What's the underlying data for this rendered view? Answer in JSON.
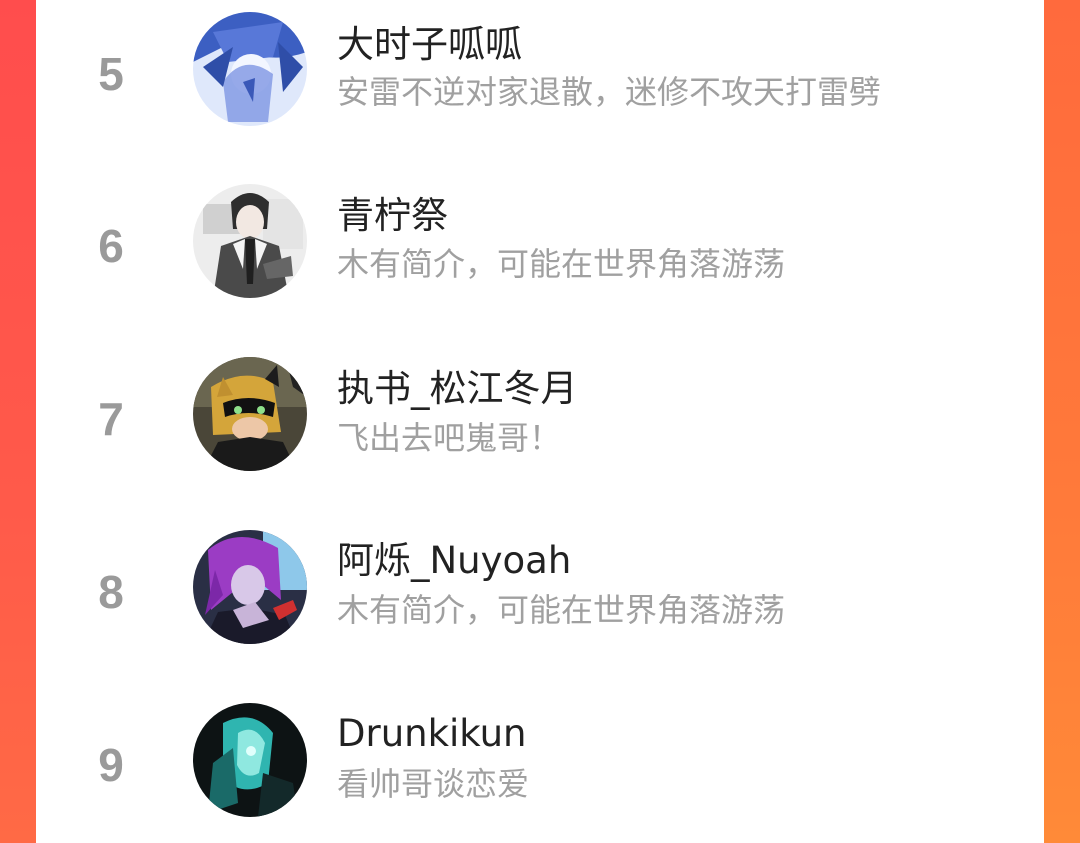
{
  "colors": {
    "left_edge": "#ff4d4d",
    "right_edge": "#ff7a3a",
    "card": "#ffffff",
    "rank_text": "#9a9a9a",
    "name_text": "#222222",
    "bio_text": "#a0a0a0"
  },
  "ranking": {
    "items": [
      {
        "rank": "5",
        "name": "大时子呱呱",
        "bio": "安雷不逆对家退散，迷修不攻天打雷劈",
        "avatar": "user-avatar-blue-anime"
      },
      {
        "rank": "6",
        "name": "青柠祭",
        "bio": "木有简介，可能在世界角落游荡",
        "avatar": "user-avatar-suit-anime"
      },
      {
        "rank": "7",
        "name": "执书_松江冬月",
        "bio": "飞出去吧嵬哥！",
        "avatar": "user-avatar-masked-hero"
      },
      {
        "rank": "8",
        "name": "阿烁_Nuyoah",
        "bio": "木有简介，可能在世界角落游荡",
        "avatar": "user-avatar-purple-hair"
      },
      {
        "rank": "9",
        "name": "Drunkikun",
        "bio": "看帅哥谈恋爱",
        "avatar": "user-avatar-cyan-dark"
      }
    ]
  }
}
